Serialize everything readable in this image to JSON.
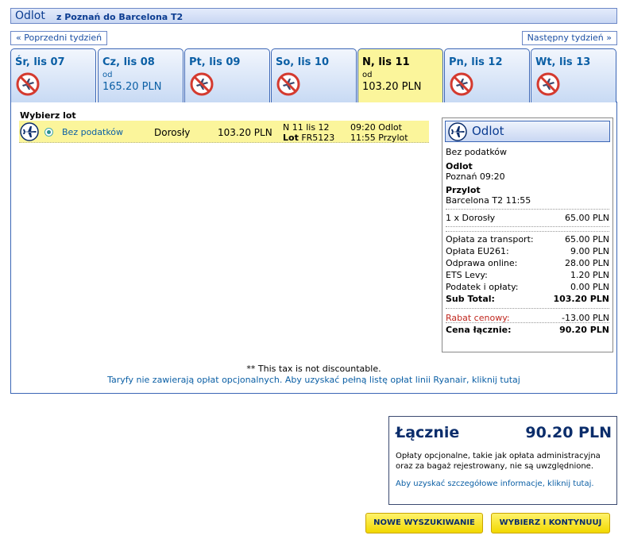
{
  "header": {
    "title": "Odlot",
    "route": "z Poznań do Barcelona T2"
  },
  "nav": {
    "prev": "« Poprzedni tydzień",
    "next": "Następny tydzień »"
  },
  "days": [
    {
      "label": "Śr, lis 07",
      "od": "",
      "price": "",
      "available": false
    },
    {
      "label": "Cz, lis 08",
      "od": "od",
      "price": "165.20 PLN",
      "available": true
    },
    {
      "label": "Pt, lis 09",
      "od": "",
      "price": "",
      "available": false
    },
    {
      "label": "So, lis 10",
      "od": "",
      "price": "",
      "available": false
    },
    {
      "label": "N, lis 11",
      "od": "od",
      "price": "103.20 PLN",
      "available": true,
      "selected": true
    },
    {
      "label": "Pn, lis 12",
      "od": "",
      "price": "",
      "available": false
    },
    {
      "label": "Wt, lis 13",
      "od": "",
      "price": "",
      "available": false
    }
  ],
  "flights": {
    "heading": "Wybierz lot",
    "row": {
      "fare": "Bez podatków",
      "pax": "Dorosły",
      "price": "103.20 PLN",
      "date": "N 11 lis 12",
      "lot_label": "Lot",
      "flight_no": "FR5123",
      "dep": "09:20 Odlot",
      "arr": "11:55 Przylot"
    }
  },
  "summary": {
    "title": "Odlot",
    "fare": "Bez podatków",
    "dep_label": "Odlot",
    "dep_value": "Poznań 09:20",
    "arr_label": "Przylot",
    "arr_value": "Barcelona T2 11:55",
    "pax_line": {
      "label": "1 x Dorosły",
      "value": "65.00 PLN"
    },
    "fees": [
      {
        "label": "Opłata za transport:",
        "value": "65.00 PLN"
      },
      {
        "label": "Opłata EU261:",
        "value": "9.00 PLN"
      },
      {
        "label": "Odprawa online:",
        "value": "28.00 PLN"
      },
      {
        "label": "ETS Levy:",
        "value": "1.20 PLN"
      },
      {
        "label": "Podatek i opłaty:",
        "value": "0.00 PLN"
      }
    ],
    "subtotal": {
      "label": "Sub Total:",
      "value": "103.20 PLN"
    },
    "discount": {
      "label": "Rabat cenowy:",
      "value": "-13.00 PLN"
    },
    "total": {
      "label": "Cena łącznie:",
      "value": "90.20 PLN"
    }
  },
  "notes": {
    "tax": "** This tax is not discountable.",
    "fares_link": "Taryfy nie zawierają opłat opcjonalnych. Aby uzyskać pełną listę opłat linii Ryanair, kliknij tutaj"
  },
  "total_box": {
    "label": "Łącznie",
    "value": "90.20 PLN",
    "text": "Opłaty opcjonalne, takie jak opłata administracyjna oraz za bagaż rejestrowany, nie są uwzględnione.",
    "link": "Aby uzyskać szczegółowe informacje, kliknij tutaj."
  },
  "buttons": {
    "new_search": "NOWE WYSZUKIWANIE",
    "continue": "WYBIERZ I KONTYNUUJ"
  },
  "icons": {
    "plane": "plane-icon",
    "no_flight": "no-flight-icon"
  },
  "colors": {
    "accent": "#0b5fa5",
    "selected_day": "#fbf59b",
    "button": "#f2d800",
    "discount": "#c0271e"
  }
}
